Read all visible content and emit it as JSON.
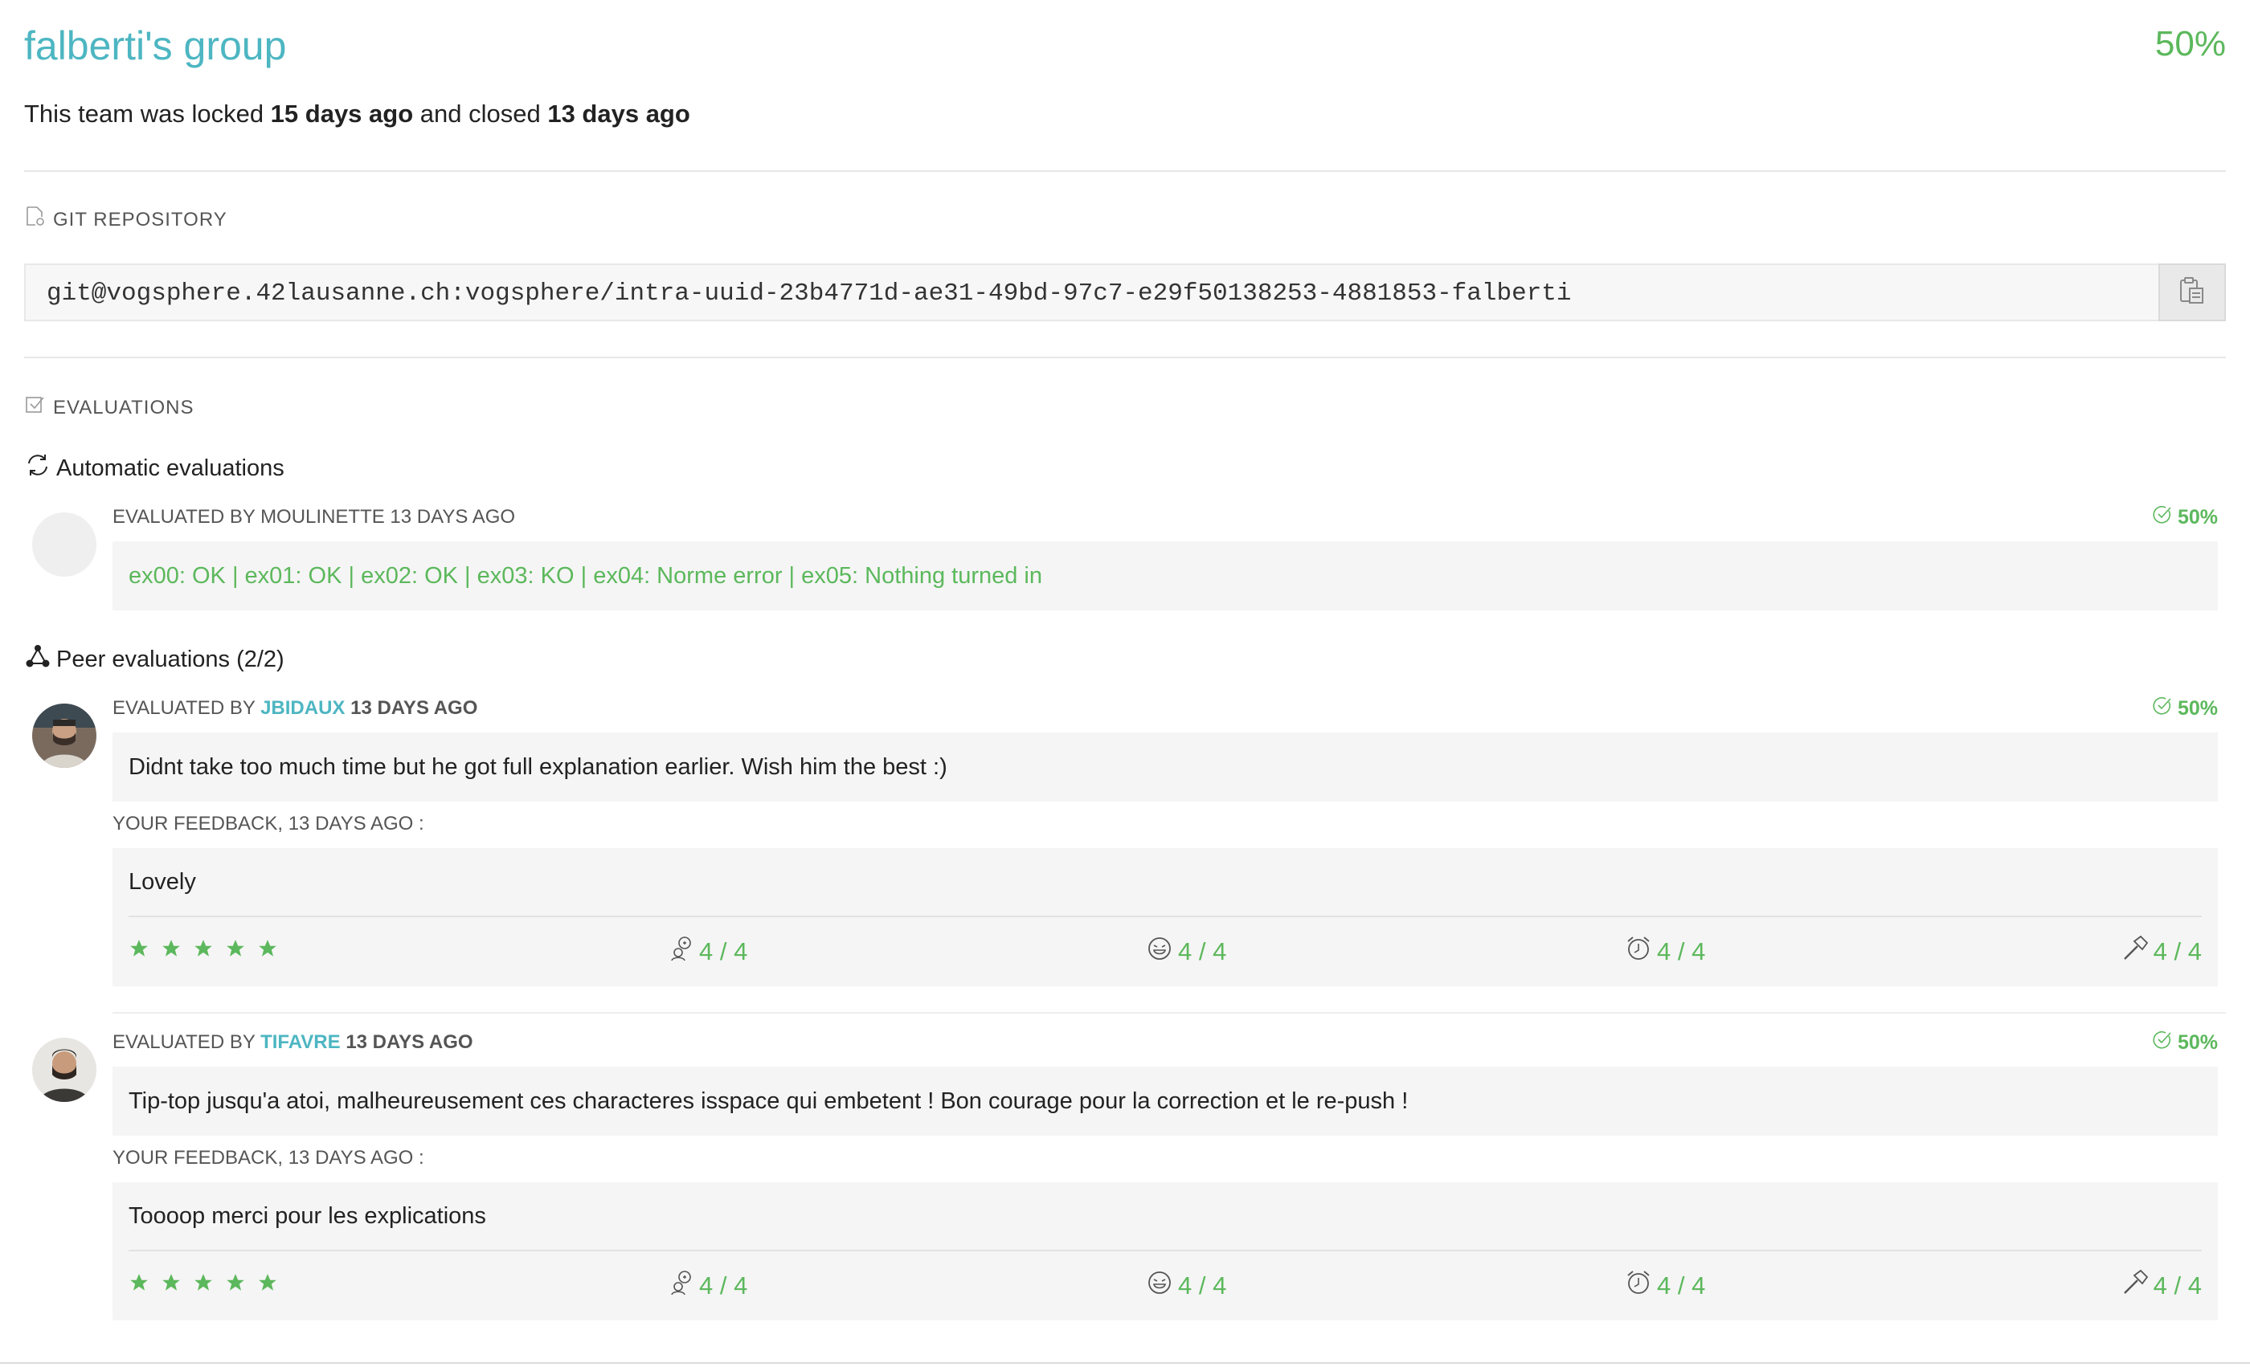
{
  "header": {
    "group_name": "falberti's group",
    "score": "50%",
    "lock_prefix": "This team was locked ",
    "locked_ago": "15 days ago",
    "lock_middle": " and closed ",
    "closed_ago": "13 days ago"
  },
  "repository": {
    "label": "GIT REPOSITORY",
    "url": "git@vogsphere.42lausanne.ch:vogsphere/intra-uuid-23b4771d-ae31-49bd-97c7-e29f50138253-4881853-falberti",
    "copy_icon": "clipboard-icon"
  },
  "evaluations": {
    "label": "EVALUATIONS",
    "automatic": {
      "heading": "Automatic evaluations",
      "meta": "EVALUATED BY MOULINETTE 13 DAYS AGO",
      "score": "50%",
      "result": "ex00: OK | ex01: OK | ex02: OK | ex03: KO | ex04: Norme error | ex05: Nothing turned in"
    },
    "peer": {
      "heading": "Peer evaluations (2/2)",
      "items": [
        {
          "prefix": "EVALUATED BY ",
          "login": "JBIDAUX",
          "when": "13 DAYS AGO",
          "score": "50%",
          "comment": "Didnt take too much time but he got full explanation earlier. Wish him the best :)",
          "feedback_label": "YOUR FEEDBACK, 13 DAYS AGO :",
          "feedback": "Lovely",
          "stars": 5,
          "interest": "4 / 4",
          "nice": "4 / 4",
          "punctuality": "4 / 4",
          "rigor": "4 / 4"
        },
        {
          "prefix": "EVALUATED BY ",
          "login": "TIFAVRE",
          "when": "13 DAYS AGO",
          "score": "50%",
          "comment": "Tip-top jusqu'a atoi, malheureusement ces characteres isspace qui embetent ! Bon courage pour la correction et le re-push !",
          "feedback_label": "YOUR FEEDBACK, 13 DAYS AGO :",
          "feedback": "Toooop merci pour les explications",
          "stars": 5,
          "interest": "4 / 4",
          "nice": "4 / 4",
          "punctuality": "4 / 4",
          "rigor": "4 / 4"
        }
      ]
    }
  },
  "colors": {
    "accent": "#4db6c2",
    "success": "#5cb85c"
  }
}
